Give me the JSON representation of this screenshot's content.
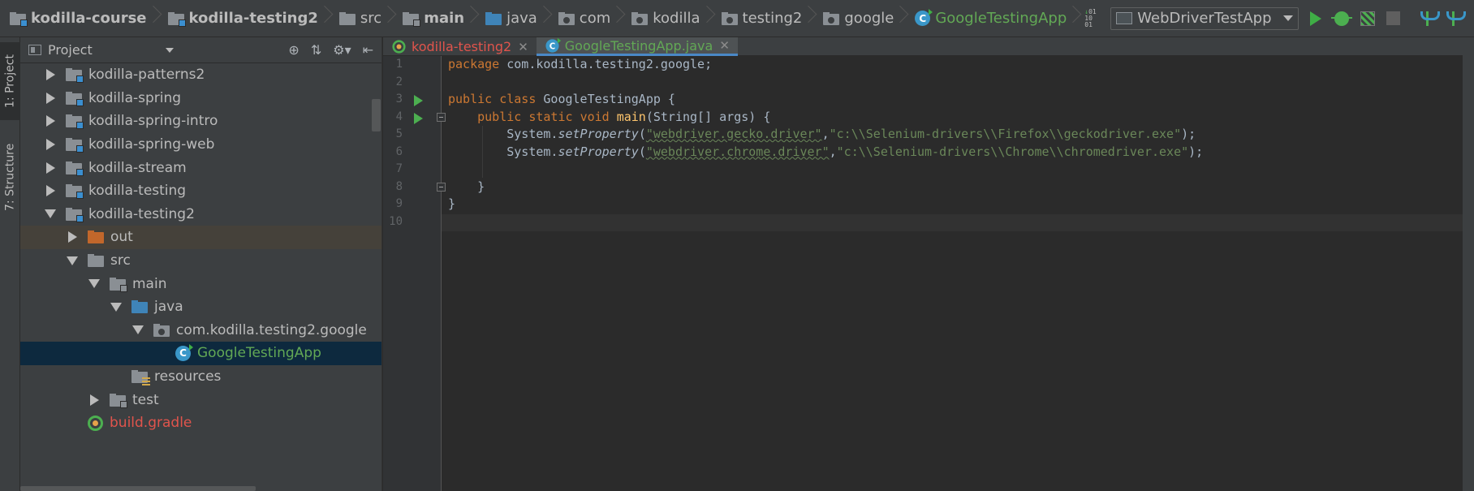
{
  "breadcrumb": [
    {
      "label": "kodilla-course",
      "icon": "folder-module-icon",
      "bold": true
    },
    {
      "label": "kodilla-testing2",
      "icon": "folder-module-icon",
      "bold": true
    },
    {
      "label": "src",
      "icon": "folder-icon"
    },
    {
      "label": "main",
      "icon": "folder-icon",
      "bold": true
    },
    {
      "label": "java",
      "icon": "folder-source-icon"
    },
    {
      "label": "com",
      "icon": "package-icon"
    },
    {
      "label": "kodilla",
      "icon": "package-icon"
    },
    {
      "label": "testing2",
      "icon": "package-icon"
    },
    {
      "label": "google",
      "icon": "package-icon"
    },
    {
      "label": "GoogleTestingApp",
      "icon": "class-icon"
    }
  ],
  "toolbar": {
    "run_config": "WebDriverTestApp",
    "buttons": [
      "binary-icon",
      "run-icon",
      "debug-icon",
      "coverage-icon",
      "stop-icon",
      "vcs-update-icon",
      "vcs-commit-icon",
      "settings-icon"
    ]
  },
  "left_strip": {
    "project_tab": "1: Project",
    "structure_tab": "7: Structure"
  },
  "project_panel": {
    "title": "Project",
    "tree": [
      {
        "label": "kodilla-patterns2",
        "level": 1,
        "expanded": false,
        "icon": "module"
      },
      {
        "label": "kodilla-spring",
        "level": 1,
        "expanded": false,
        "icon": "module"
      },
      {
        "label": "kodilla-spring-intro",
        "level": 1,
        "expanded": false,
        "icon": "module"
      },
      {
        "label": "kodilla-spring-web",
        "level": 1,
        "expanded": false,
        "icon": "module"
      },
      {
        "label": "kodilla-stream",
        "level": 1,
        "expanded": false,
        "icon": "module"
      },
      {
        "label": "kodilla-testing",
        "level": 1,
        "expanded": false,
        "icon": "module"
      },
      {
        "label": "kodilla-testing2",
        "level": 1,
        "expanded": true,
        "icon": "module"
      },
      {
        "label": "out",
        "level": 2,
        "expanded": false,
        "icon": "excluded"
      },
      {
        "label": "src",
        "level": 2,
        "expanded": true,
        "icon": "folder"
      },
      {
        "label": "main",
        "level": 3,
        "expanded": true,
        "icon": "folder"
      },
      {
        "label": "java",
        "level": 4,
        "expanded": true,
        "icon": "source"
      },
      {
        "label": "com.kodilla.testing2.google",
        "level": 5,
        "expanded": true,
        "icon": "package"
      },
      {
        "label": "GoogleTestingApp",
        "level": 6,
        "expanded": null,
        "icon": "class"
      },
      {
        "label": "resources",
        "level": 4,
        "expanded": null,
        "icon": "resources"
      },
      {
        "label": "test",
        "level": 3,
        "expanded": false,
        "icon": "folder"
      },
      {
        "label": "build.gradle",
        "level": 2,
        "expanded": null,
        "icon": "gradle"
      }
    ]
  },
  "editor_tabs": [
    {
      "label": "kodilla-testing2",
      "active": false,
      "icon": "gradle"
    },
    {
      "label": "GoogleTestingApp.java",
      "active": true,
      "icon": "class"
    }
  ],
  "code": {
    "line_numbers": [
      "1",
      "2",
      "3",
      "4",
      "5",
      "6",
      "7",
      "8",
      "9",
      "10"
    ],
    "lines": [
      "package com.kodilla.testing2.google;",
      "",
      "public class GoogleTestingApp {",
      "    public static void main(String[] args) {",
      "        System.setProperty(\"webdriver.gecko.driver\",\"c:\\\\Selenium-drivers\\\\Firefox\\\\geckodriver.exe\");",
      "        System.setProperty(\"webdriver.chrome.driver\",\"c:\\\\Selenium-drivers\\\\Chrome\\\\chromedriver.exe\");",
      "",
      "    }",
      "}",
      ""
    ],
    "tokens": {
      "kw_package": "package",
      "pkg_name": " com.kodilla.testing2.google;",
      "kw_public": "public",
      "kw_class": "class",
      "class_name": " GoogleTestingApp {",
      "kw_static": "static",
      "kw_void": "void",
      "method_main": "main",
      "main_args": "(String[] args) {",
      "sys": "System.",
      "set_prop": "setProperty",
      "open_paren": "(",
      "str_gecko_key": "\"webdriver.gecko.driver\"",
      "comma": ",",
      "str_gecko_val": "\"c:\\\\Selenium-drivers\\\\Firefox\\\\geckodriver.exe\"",
      "str_chrome_key": "\"webdriver.chrome.driver\"",
      "str_chrome_val": "\"c:\\\\Selenium-drivers\\\\Chrome\\\\chromedriver.exe\"",
      "close_stmt": ");",
      "close_brace_inner": "}",
      "close_brace_outer": "}"
    }
  },
  "colors": {
    "keyword": "#cc7832",
    "string": "#6a8759",
    "function": "#ffc66d",
    "text": "#a9b7c6",
    "class_green": "#62a855",
    "gradle_red": "#e0544c",
    "selection": "#0d293e"
  }
}
